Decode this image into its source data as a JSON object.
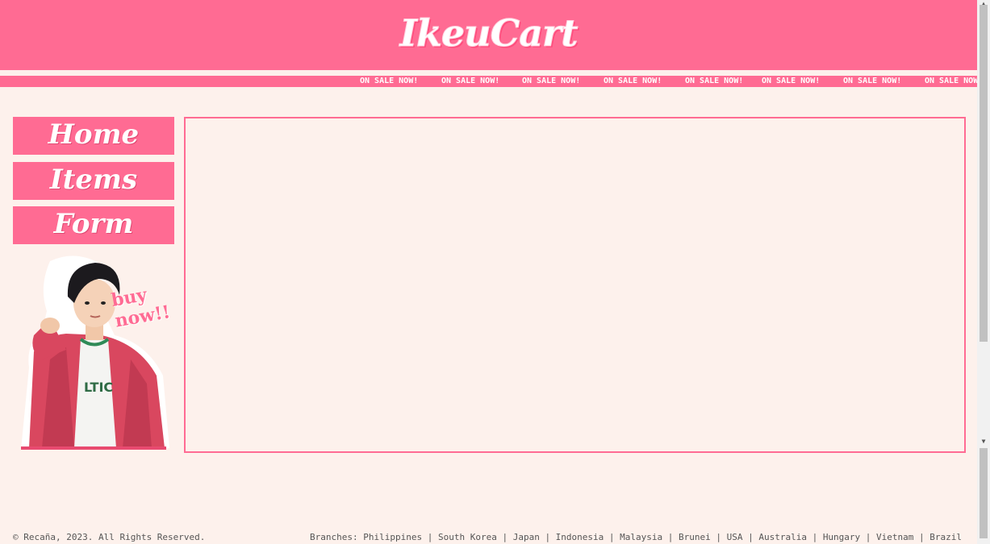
{
  "header": {
    "logo_text": "IkeuCart"
  },
  "marquee": {
    "items": [
      "ON SALE NOW!",
      "ON SALE NOW!",
      "ON SALE NOW!",
      "ON SALE NOW!",
      "ON SALE NOW!",
      "ON SALE NOW!",
      "ON SALE NOW!",
      "ON SALE NOW"
    ]
  },
  "nav": {
    "home": "Home",
    "items": "Items",
    "form": "Form"
  },
  "promo": {
    "caption": "buy now!!"
  },
  "footer": {
    "copyright": "© Recaña, 2023. All Rights Reserved.",
    "branches": "Branches: Philippines | South Korea | Japan | Indonesia | Malaysia | Brunei | USA | Australia | Hungary | Vietnam | Brazil"
  },
  "colors": {
    "accent": "#ff6b93",
    "background": "#fdf1ec"
  }
}
